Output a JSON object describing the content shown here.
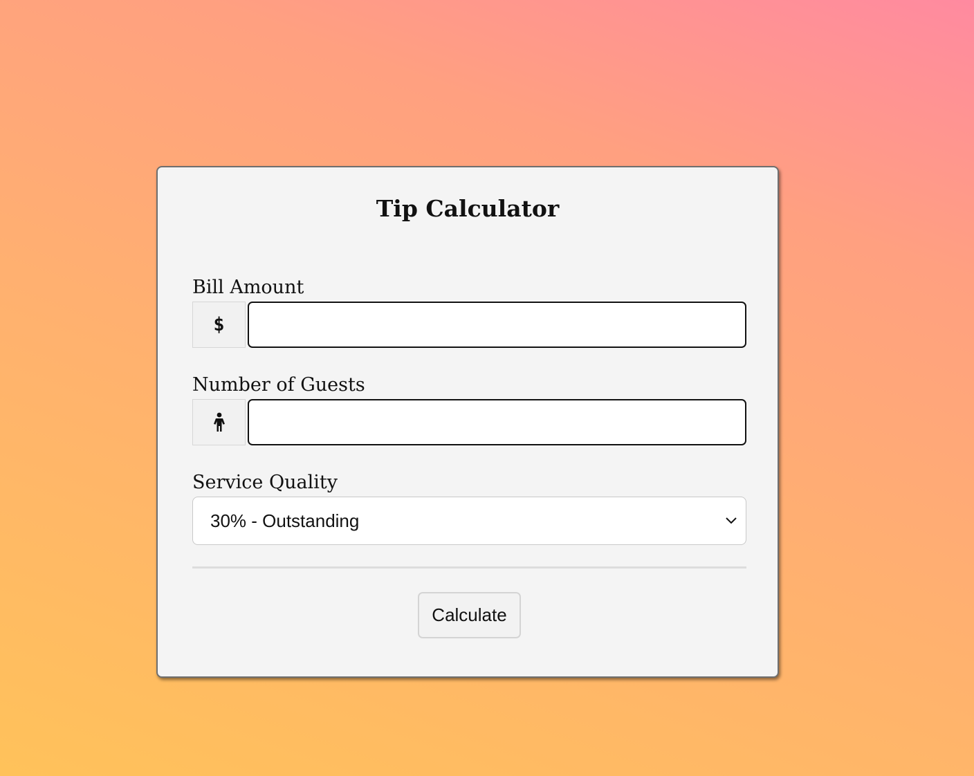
{
  "title": "Tip Calculator",
  "bill": {
    "label": "Bill Amount",
    "addon_text": "$",
    "value": ""
  },
  "guests": {
    "label": "Number of Guests",
    "addon_icon": "person-icon",
    "value": ""
  },
  "service": {
    "label": "Service Quality",
    "selected": "30% - Outstanding"
  },
  "calculate_label": "Calculate"
}
